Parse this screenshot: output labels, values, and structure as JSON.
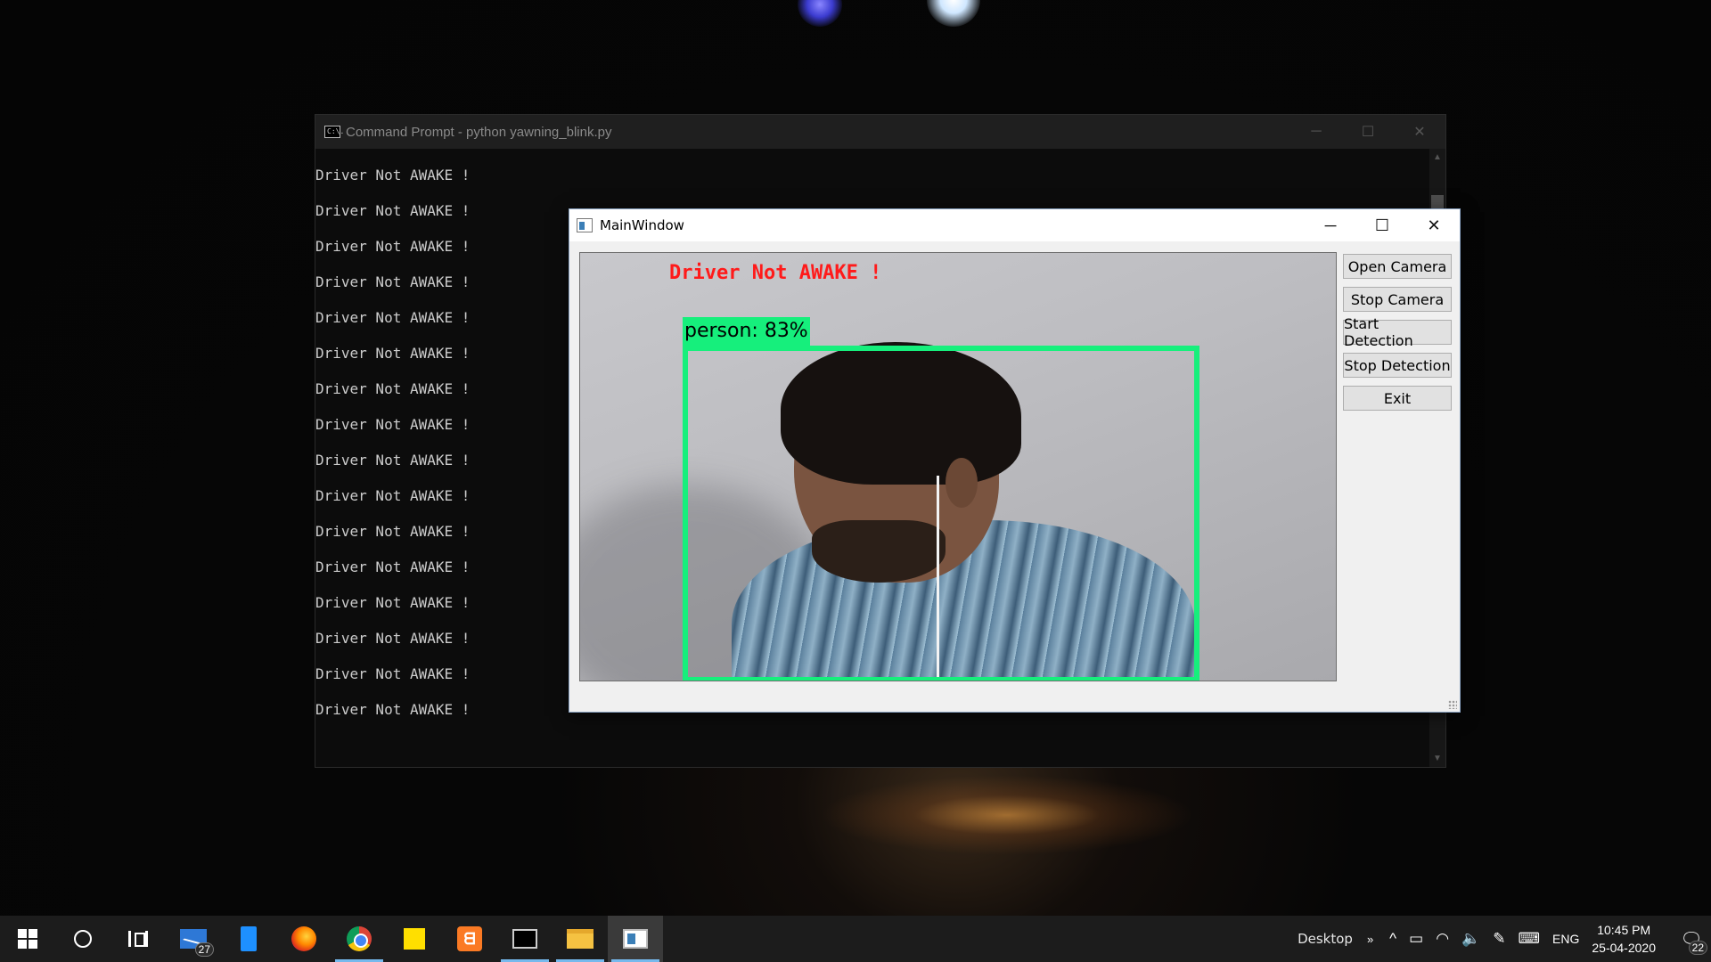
{
  "cmd": {
    "title": "Command Prompt - python  yawning_blink.py",
    "icon_text": "C:\\.",
    "lines": [
      "Driver Not AWAKE !",
      "Driver Not AWAKE !",
      "Driver Not AWAKE !",
      "Driver Not AWAKE !",
      "Driver Not AWAKE !",
      "Driver Not AWAKE !",
      "Driver Not AWAKE !",
      "Driver Not AWAKE !",
      "Driver Not AWAKE !",
      "Driver Not AWAKE !",
      "Driver Not AWAKE !",
      "Driver Not AWAKE !",
      "Driver Not AWAKE !",
      "Driver Not AWAKE !",
      "Driver Not AWAKE !",
      "Driver Not AWAKE !"
    ],
    "controls": {
      "minimize": "─",
      "maximize": "☐",
      "close": "✕"
    }
  },
  "main_window": {
    "title": "MainWindow",
    "controls": {
      "minimize": "─",
      "maximize": "☐",
      "close": "✕"
    },
    "video": {
      "alert_text": "Driver Not AWAKE !",
      "detection_label": "person: 83%",
      "alert_color": "#ff1a1a",
      "box_color": "#16ef7c"
    },
    "buttons": {
      "open_camera": "Open Camera",
      "stop_camera": "Stop Camera",
      "start_detection": "Start Detection",
      "stop_detection": "Stop Detection",
      "exit": "Exit"
    }
  },
  "taskbar": {
    "mail_badge": "27",
    "xampp_glyph": "ᗺ",
    "tray": {
      "desktop": "Desktop",
      "chevron": "»",
      "up_arrow": "^",
      "battery_glyph": "▭",
      "wifi_glyph": "◠",
      "volume_glyph": "🔈",
      "pen_glyph": "✎",
      "keyboard_glyph": "⌨",
      "lang": "ENG",
      "time": "10:45 PM",
      "date": "25-04-2020",
      "notification_glyph": "🗨",
      "notification_badge": "22"
    }
  }
}
